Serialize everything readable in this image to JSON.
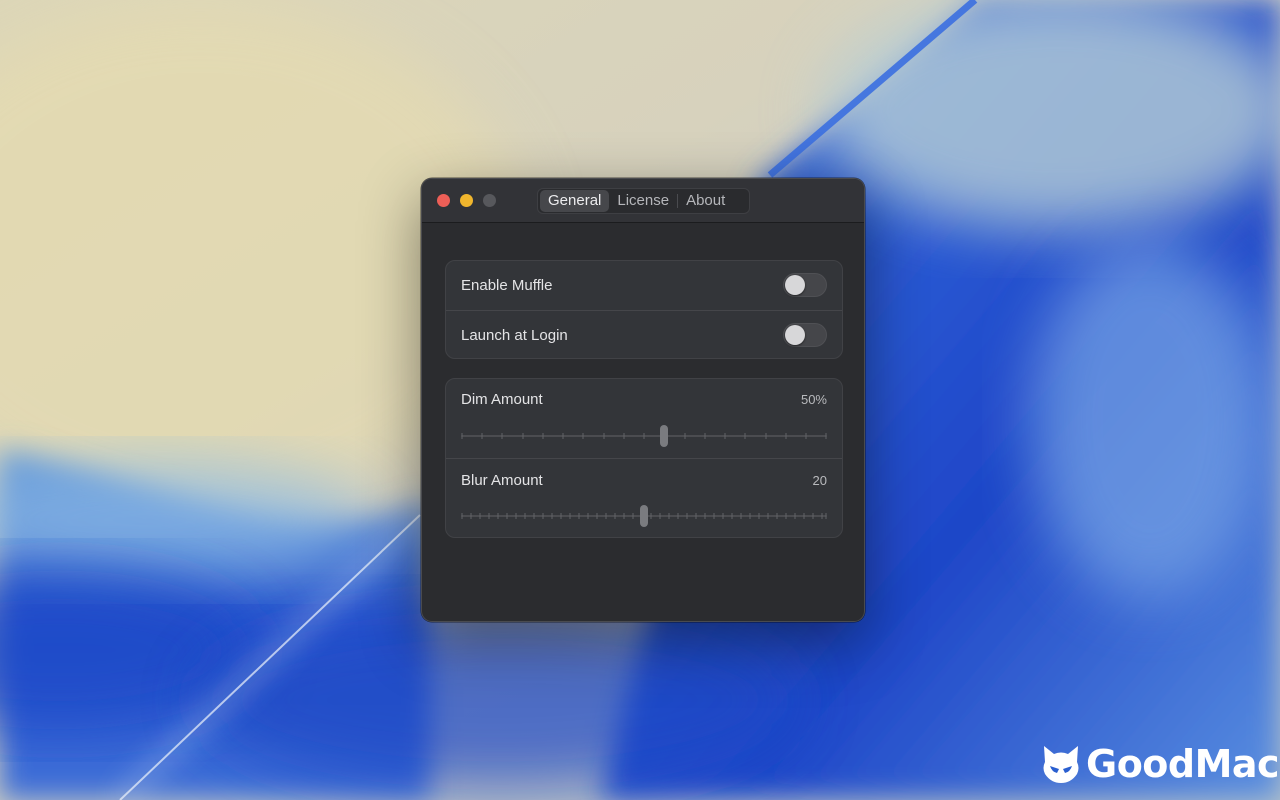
{
  "window": {
    "tabs": [
      {
        "label": "General",
        "active": true
      },
      {
        "label": "License",
        "active": false
      },
      {
        "label": "About",
        "active": false
      }
    ]
  },
  "general": {
    "enable_muffle": {
      "label": "Enable Muffle",
      "on": false
    },
    "launch_at_login": {
      "label": "Launch at Login",
      "on": false
    },
    "dim_amount": {
      "label": "Dim Amount",
      "value_text": "50%",
      "value": 0.5
    },
    "blur_amount": {
      "label": "Blur Amount",
      "value_text": "20",
      "value": 20
    }
  },
  "watermark": {
    "brand": "GoodMac"
  },
  "colors": {
    "close": "#ed5f57",
    "minimize": "#f0b62d",
    "zoom_disabled": "#57585c",
    "window_bg": "#2b2c2f"
  }
}
